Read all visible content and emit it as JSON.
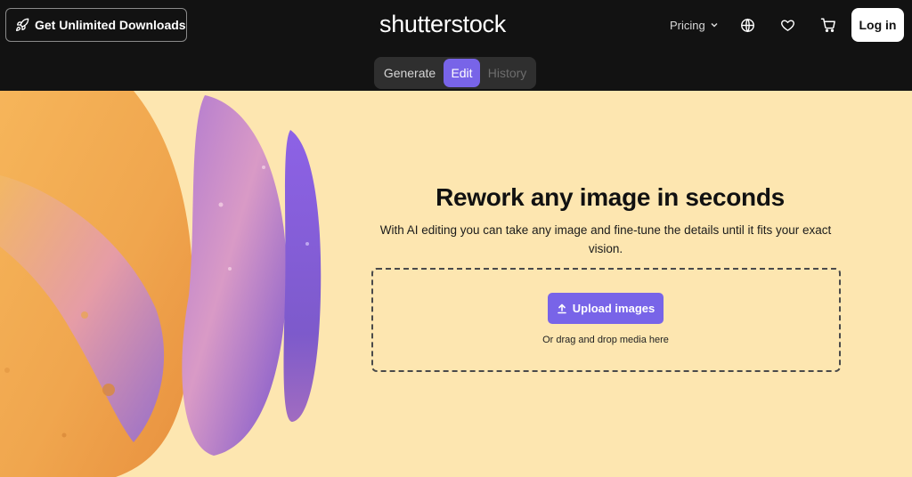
{
  "header": {
    "promo_label": "Get Unlimited Downloads",
    "logo_text": "shutterstock",
    "pricing_label": "Pricing",
    "login_label": "Log in"
  },
  "tabs": [
    {
      "label": "Generate",
      "state": "default"
    },
    {
      "label": "Edit",
      "state": "active"
    },
    {
      "label": "History",
      "state": "disabled"
    }
  ],
  "hero": {
    "title": "Rework any image in seconds",
    "subtitle": "With AI editing you can take any image and fine-tune the details until it fits your exact vision.",
    "upload_label": "Upload images",
    "drag_hint": "Or drag and drop media here"
  },
  "colors": {
    "accent": "#7864e8",
    "header_bg": "#121212",
    "page_bg": "#fde6b0"
  },
  "icons": [
    "rocket-icon",
    "chevron-down-icon",
    "globe-icon",
    "heart-icon",
    "cart-icon",
    "upload-icon"
  ]
}
